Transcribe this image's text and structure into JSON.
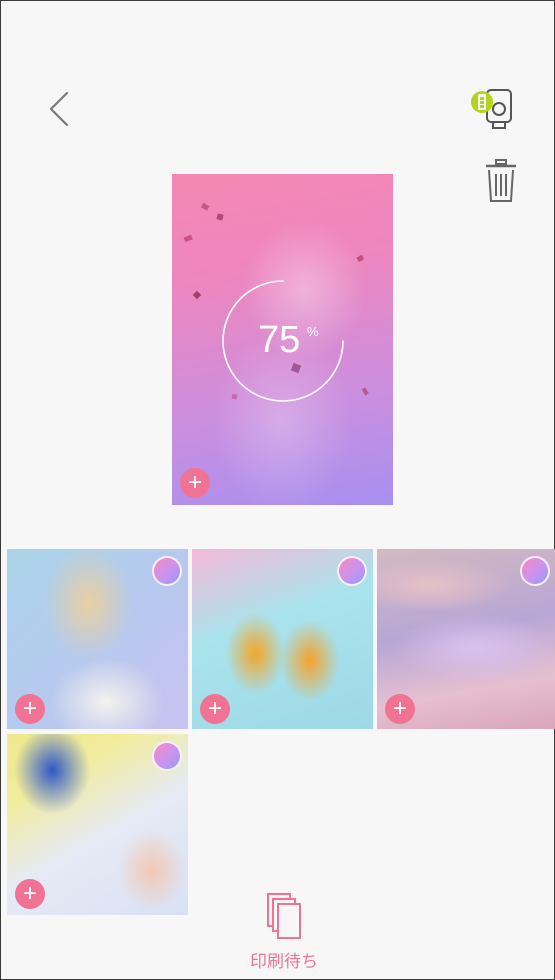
{
  "header": {
    "back_icon": "chevron-left-icon",
    "printer_icon": "printer-battery-icon",
    "delete_icon": "trash-icon"
  },
  "preview": {
    "progress_value": "75",
    "progress_unit": "%",
    "progress_fraction": 0.75,
    "add_label": "+"
  },
  "thumbnails": [
    {
      "add_label": "+"
    },
    {
      "add_label": "+"
    },
    {
      "add_label": "+"
    },
    {
      "add_label": "+"
    }
  ],
  "footer": {
    "queue_label": "印刷待ち",
    "queue_icon": "copies-icon"
  },
  "colors": {
    "accent": "#f07394",
    "battery": "#b5d31b",
    "icon_gray": "#7a7a7a"
  }
}
